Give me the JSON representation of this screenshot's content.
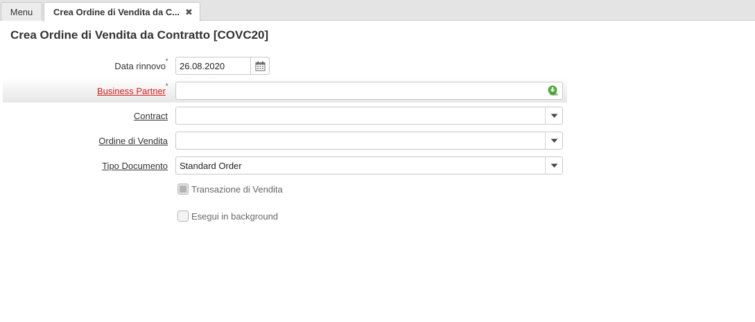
{
  "tabs": {
    "menu_label": "Menu",
    "active_label": "Crea Ordine di Vendita da C...",
    "close_glyph": "✖"
  },
  "page": {
    "title": "Crea Ordine di Vendita da Contratto [COVC20]"
  },
  "form": {
    "data_rinnovo": {
      "label": "Data rinnovo",
      "required": "*",
      "value": "26.08.2020"
    },
    "business_partner": {
      "label": "Business Partner",
      "required": "*",
      "value": ""
    },
    "contract": {
      "label": "Contract",
      "value": ""
    },
    "ordine_di_vendita": {
      "label": "Ordine di Vendita",
      "value": ""
    },
    "tipo_documento": {
      "label": "Tipo Documento",
      "value": "Standard Order"
    },
    "transazione_di_vendita": {
      "label": "Transazione di Vendita",
      "checked": true,
      "disabled": true
    },
    "esegui_in_background": {
      "label": "Esegui in background",
      "checked": false
    }
  },
  "colors": {
    "required_link": "#d32020",
    "search_icon_green": "#3a9a2a"
  },
  "icons": {
    "calendar": "calendar-icon",
    "search": "search-arrow-icon",
    "dropdown": "caret-down-icon",
    "close": "close-icon"
  }
}
